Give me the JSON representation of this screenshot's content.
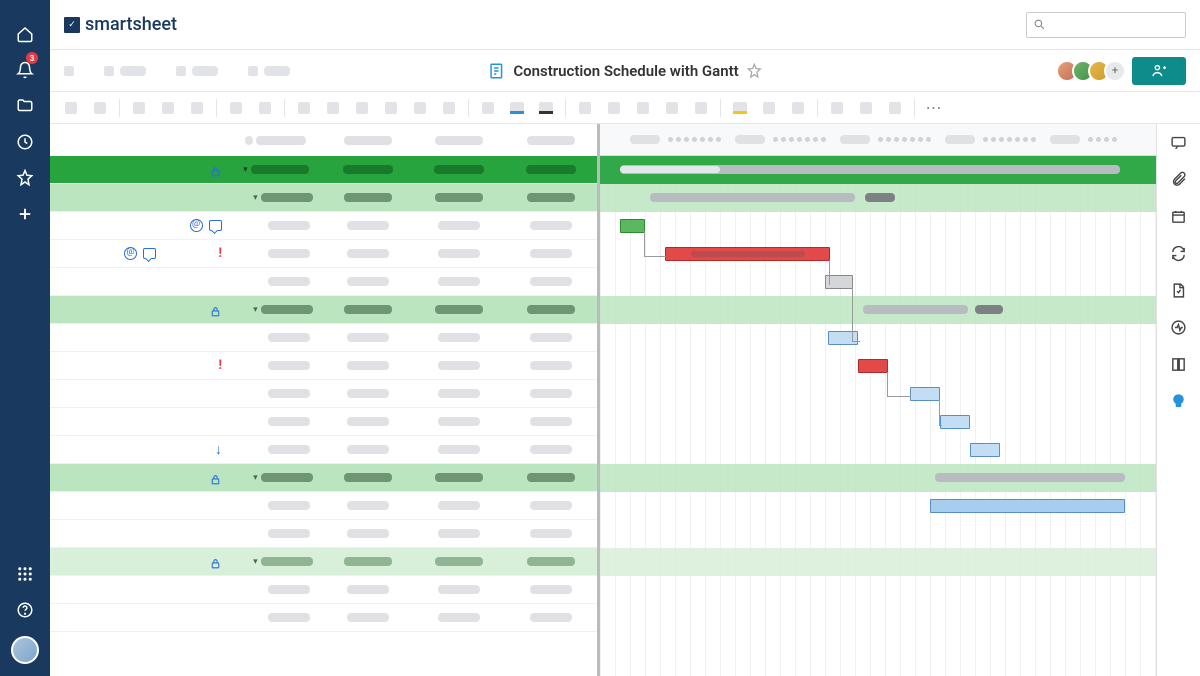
{
  "brand": "smartsheet",
  "notification_count": "3",
  "sheet_title": "Construction Schedule with Gantt",
  "search_placeholder": "",
  "avatars": [
    "user1",
    "user2",
    "user3"
  ]
}
